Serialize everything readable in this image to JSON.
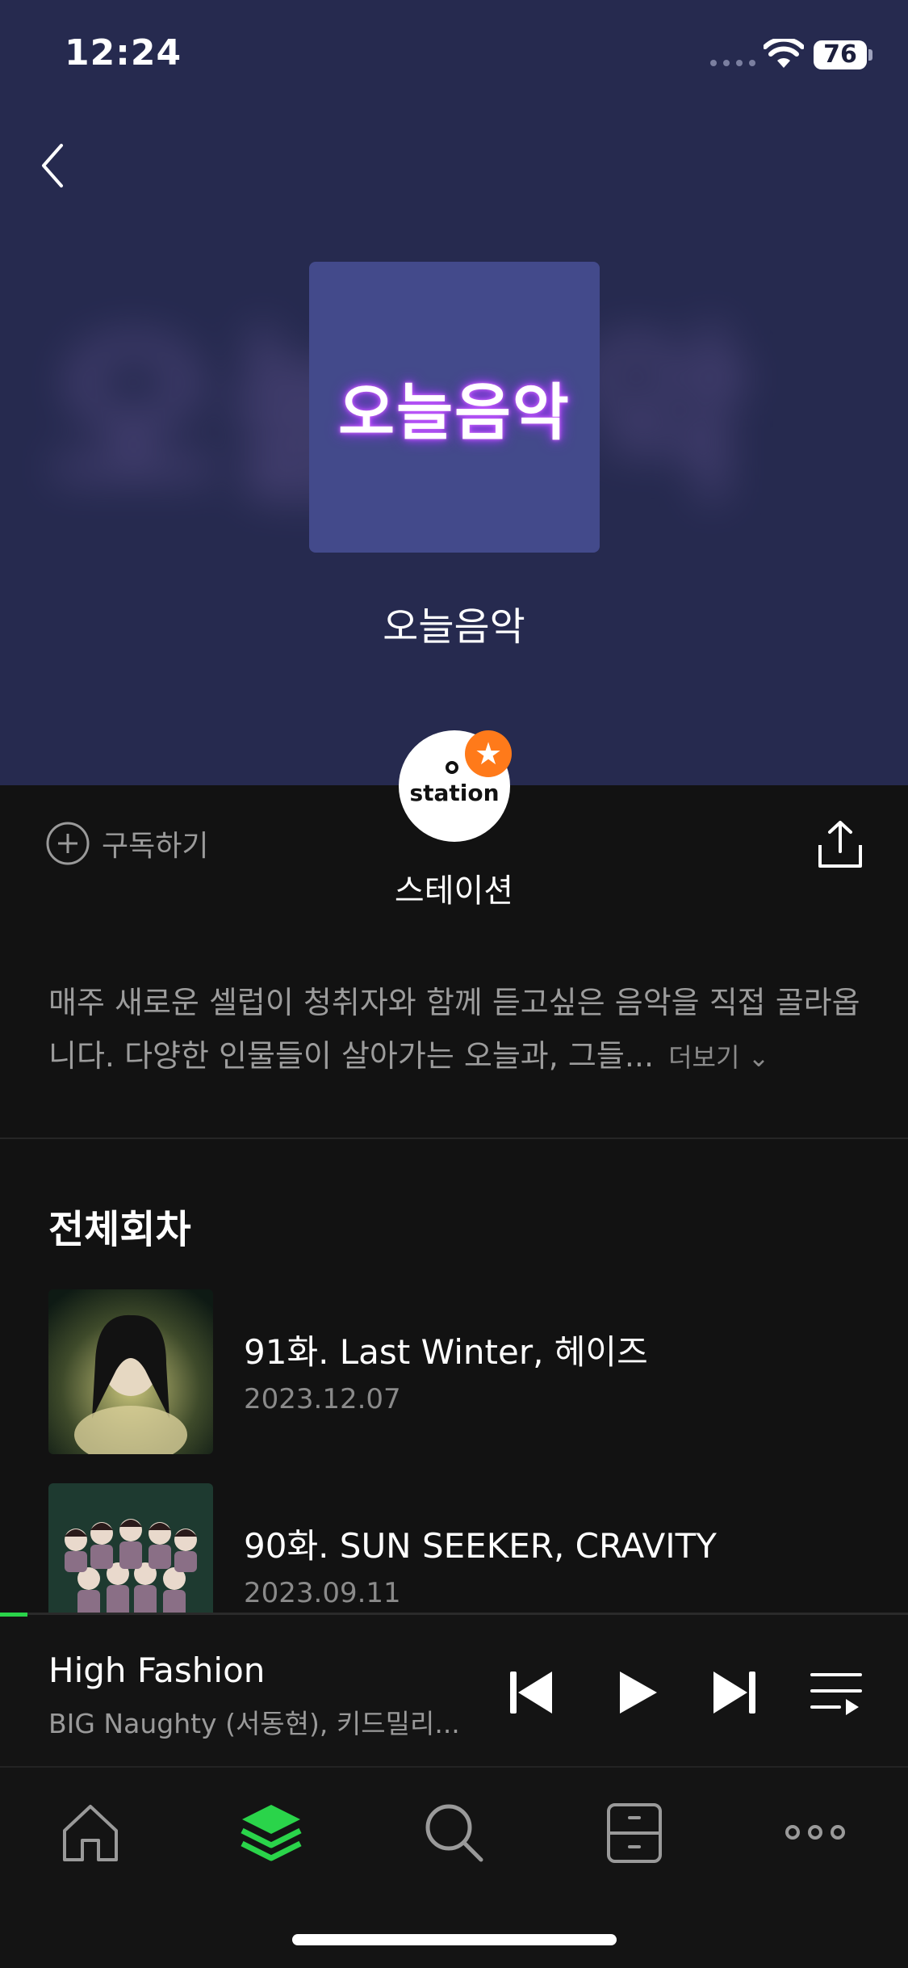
{
  "status_bar": {
    "time": "12:24",
    "battery": "76"
  },
  "hero": {
    "cover_text": "오늘음악",
    "blur_text": "오늘음악",
    "title": "오늘음악"
  },
  "channel": {
    "subscribe_label": "구독하기",
    "avatar_text": "station",
    "name": "스테이션"
  },
  "description": {
    "text": "매주 새로운 셀럽이 청취자와 함께 듣고싶은 음악을 직접 골라옵니다. 다양한 인물들이 살아가는 오늘과, 그들...",
    "more_label": "더보기"
  },
  "episodes_section": {
    "title": "전체회차",
    "items": [
      {
        "title": "91화. Last Winter, 헤이즈",
        "date": "2023.12.07"
      },
      {
        "title": "90화. SUN SEEKER, CRAVITY",
        "date": "2023.09.11"
      }
    ]
  },
  "now_playing": {
    "title": "High Fashion",
    "artist": "BIG Naughty (서동현), 키드밀리...",
    "progress": 0.03
  },
  "tab_bar": {
    "items": [
      {
        "icon": "home-icon",
        "active": false
      },
      {
        "icon": "layers-icon",
        "active": true
      },
      {
        "icon": "search-icon",
        "active": false
      },
      {
        "icon": "library-icon",
        "active": false
      },
      {
        "icon": "more-icon",
        "active": false
      }
    ]
  },
  "colors": {
    "accent": "#2ad44a",
    "hero_bg": "#262a4f",
    "badge": "#ff7a1a"
  }
}
